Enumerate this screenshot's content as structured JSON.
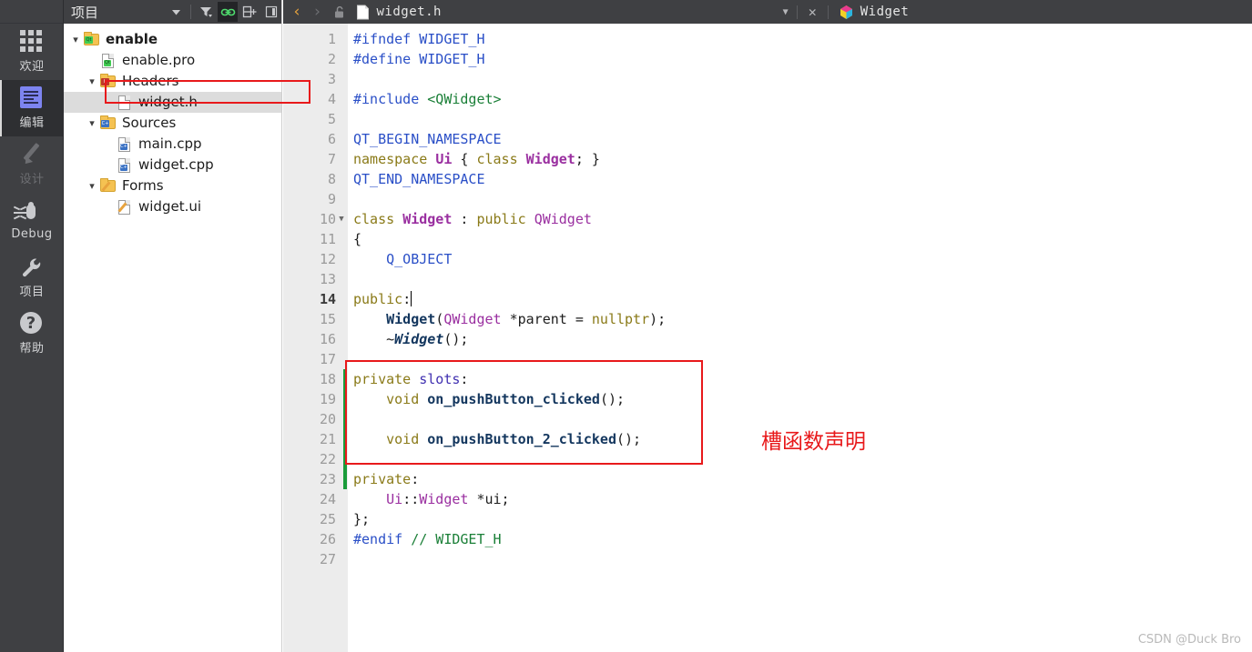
{
  "modebar": {
    "items": [
      {
        "label": "欢迎",
        "icon": "grid-icon",
        "state": "normal"
      },
      {
        "label": "编辑",
        "icon": "edit-document-icon",
        "state": "active"
      },
      {
        "label": "设计",
        "icon": "pencil-icon",
        "state": "disabled"
      },
      {
        "label": "Debug",
        "icon": "bug-icon",
        "state": "normal"
      },
      {
        "label": "项目",
        "icon": "wrench-icon",
        "state": "normal"
      },
      {
        "label": "帮助",
        "icon": "question-circle-icon",
        "state": "normal"
      }
    ]
  },
  "project_panel": {
    "title": "项目",
    "toolbar": [
      {
        "name": "view-selector-dropdown",
        "icon": "chevron-down-icon"
      },
      {
        "name": "filter-button",
        "icon": "filter-funnel-icon"
      },
      {
        "name": "sync-with-editor-toggle",
        "icon": "link-icon",
        "active": true
      },
      {
        "name": "split-button",
        "icon": "split-add-icon"
      },
      {
        "name": "collapse-sidebar-button",
        "icon": "collapse-left-icon"
      }
    ],
    "tree": [
      {
        "label": "enable",
        "indent": 0,
        "twisty": "v",
        "icon": "folder-qt-icon",
        "bold": true,
        "selected": false
      },
      {
        "label": "enable.pro",
        "indent": 1,
        "twisty": "",
        "icon": "file-qt-icon",
        "bold": false,
        "selected": false
      },
      {
        "label": "Headers",
        "indent": 1,
        "twisty": "v",
        "icon": "folder-h-icon",
        "bold": false,
        "selected": false
      },
      {
        "label": "widget.h",
        "indent": 2,
        "twisty": "",
        "icon": "file-header-icon",
        "bold": false,
        "selected": true
      },
      {
        "label": "Sources",
        "indent": 1,
        "twisty": "v",
        "icon": "folder-cpp-icon",
        "bold": false,
        "selected": false
      },
      {
        "label": "main.cpp",
        "indent": 2,
        "twisty": "",
        "icon": "file-cpp-icon",
        "bold": false,
        "selected": false
      },
      {
        "label": "widget.cpp",
        "indent": 2,
        "twisty": "",
        "icon": "file-cpp-icon",
        "bold": false,
        "selected": false
      },
      {
        "label": "Forms",
        "indent": 1,
        "twisty": "v",
        "icon": "folder-ui-icon",
        "bold": false,
        "selected": false
      },
      {
        "label": "widget.ui",
        "indent": 2,
        "twisty": "",
        "icon": "file-ui-icon",
        "bold": false,
        "selected": false
      }
    ]
  },
  "editor": {
    "toolbar": {
      "back_label": "‹",
      "forward_label": "›",
      "lock_icon": "unlock-icon",
      "file_icon": "file-icon",
      "file_name": "widget.h",
      "dropdown_icon": "chevron-down-icon",
      "close_label": "✕",
      "symbol_icon": "class-symbol-icon",
      "symbol_name": "Widget"
    },
    "cursor_line": 14,
    "changed_lines": [
      18,
      19,
      20,
      21,
      22,
      23
    ],
    "lines": [
      {
        "n": 1,
        "fold": "",
        "tokens": [
          {
            "t": "#ifndef ",
            "c": "t-pre"
          },
          {
            "t": "WIDGET_H",
            "c": "t-pre"
          }
        ]
      },
      {
        "n": 2,
        "fold": "",
        "tokens": [
          {
            "t": "#define ",
            "c": "t-pre"
          },
          {
            "t": "WIDGET_H",
            "c": "t-pre"
          }
        ]
      },
      {
        "n": 3,
        "fold": "",
        "tokens": []
      },
      {
        "n": 4,
        "fold": "",
        "tokens": [
          {
            "t": "#include ",
            "c": "t-pre"
          },
          {
            "t": "<QWidget>",
            "c": "t-inc"
          }
        ]
      },
      {
        "n": 5,
        "fold": "",
        "tokens": []
      },
      {
        "n": 6,
        "fold": "",
        "tokens": [
          {
            "t": "QT_BEGIN_NAMESPACE",
            "c": "t-mac"
          }
        ]
      },
      {
        "n": 7,
        "fold": "",
        "tokens": [
          {
            "t": "namespace ",
            "c": "t-kw"
          },
          {
            "t": "Ui",
            "c": "t-typeb"
          },
          {
            "t": " { ",
            "c": "t-op"
          },
          {
            "t": "class ",
            "c": "t-kw"
          },
          {
            "t": "Widget",
            "c": "t-typeb"
          },
          {
            "t": "; }",
            "c": "t-op"
          }
        ]
      },
      {
        "n": 8,
        "fold": "",
        "tokens": [
          {
            "t": "QT_END_NAMESPACE",
            "c": "t-mac"
          }
        ]
      },
      {
        "n": 9,
        "fold": "",
        "tokens": []
      },
      {
        "n": 10,
        "fold": "▼",
        "tokens": [
          {
            "t": "class ",
            "c": "t-kw"
          },
          {
            "t": "Widget",
            "c": "t-typeb"
          },
          {
            "t": " : ",
            "c": "t-op"
          },
          {
            "t": "public ",
            "c": "t-kw"
          },
          {
            "t": "QWidget",
            "c": "t-type"
          }
        ]
      },
      {
        "n": 11,
        "fold": "",
        "tokens": [
          {
            "t": "{",
            "c": "t-op"
          }
        ]
      },
      {
        "n": 12,
        "fold": "",
        "tokens": [
          {
            "t": "    Q_OBJECT",
            "c": "t-qobj"
          }
        ]
      },
      {
        "n": 13,
        "fold": "",
        "tokens": []
      },
      {
        "n": 14,
        "fold": "",
        "tokens": [
          {
            "t": "public",
            "c": "t-kw"
          },
          {
            "t": ":",
            "c": "t-op"
          }
        ]
      },
      {
        "n": 15,
        "fold": "",
        "tokens": [
          {
            "t": "    ",
            "c": "t-plain"
          },
          {
            "t": "Widget",
            "c": "t-ctor"
          },
          {
            "t": "(",
            "c": "t-op"
          },
          {
            "t": "QWidget",
            "c": "t-type"
          },
          {
            "t": " *parent = ",
            "c": "t-op"
          },
          {
            "t": "nullptr",
            "c": "t-kw"
          },
          {
            "t": ");",
            "c": "t-op"
          }
        ]
      },
      {
        "n": 16,
        "fold": "",
        "tokens": [
          {
            "t": "    ~",
            "c": "t-op"
          },
          {
            "t": "Widget",
            "c": "t-dtor"
          },
          {
            "t": "();",
            "c": "t-op"
          }
        ]
      },
      {
        "n": 17,
        "fold": "",
        "tokens": []
      },
      {
        "n": 18,
        "fold": "",
        "tokens": [
          {
            "t": "private ",
            "c": "t-kw"
          },
          {
            "t": "slots",
            "c": "t-slot"
          },
          {
            "t": ":",
            "c": "t-op"
          }
        ]
      },
      {
        "n": 19,
        "fold": "",
        "tokens": [
          {
            "t": "    void ",
            "c": "t-kw"
          },
          {
            "t": "on_pushButton_clicked",
            "c": "t-fn"
          },
          {
            "t": "();",
            "c": "t-op"
          }
        ]
      },
      {
        "n": 20,
        "fold": "",
        "tokens": []
      },
      {
        "n": 21,
        "fold": "",
        "tokens": [
          {
            "t": "    void ",
            "c": "t-kw"
          },
          {
            "t": "on_pushButton_2_clicked",
            "c": "t-fn"
          },
          {
            "t": "();",
            "c": "t-op"
          }
        ]
      },
      {
        "n": 22,
        "fold": "",
        "tokens": []
      },
      {
        "n": 23,
        "fold": "",
        "tokens": [
          {
            "t": "private",
            "c": "t-kw"
          },
          {
            "t": ":",
            "c": "t-op"
          }
        ]
      },
      {
        "n": 24,
        "fold": "",
        "tokens": [
          {
            "t": "    ",
            "c": "t-plain"
          },
          {
            "t": "Ui",
            "c": "t-type"
          },
          {
            "t": "::",
            "c": "t-op"
          },
          {
            "t": "Widget",
            "c": "t-type"
          },
          {
            "t": " *ui;",
            "c": "t-op"
          }
        ]
      },
      {
        "n": 25,
        "fold": "",
        "tokens": [
          {
            "t": "};",
            "c": "t-op"
          }
        ]
      },
      {
        "n": 26,
        "fold": "",
        "tokens": [
          {
            "t": "#endif ",
            "c": "t-pre"
          },
          {
            "t": "// WIDGET_H",
            "c": "t-cmt"
          }
        ]
      },
      {
        "n": 27,
        "fold": "",
        "tokens": []
      }
    ]
  },
  "annotation": {
    "text": "槽函数声明",
    "color": "#e8191b"
  },
  "watermark": {
    "text": "CSDN @Duck Bro"
  },
  "colors": {
    "chrome_dark": "#3f4043",
    "panel_bg": "#ffffff",
    "gutter_bg": "#ececec",
    "selection_bg": "#dcdcdc",
    "highlight_red": "#e8191b",
    "change_green": "#1a9c3a",
    "active_mode_bg": "#2e2f32"
  }
}
